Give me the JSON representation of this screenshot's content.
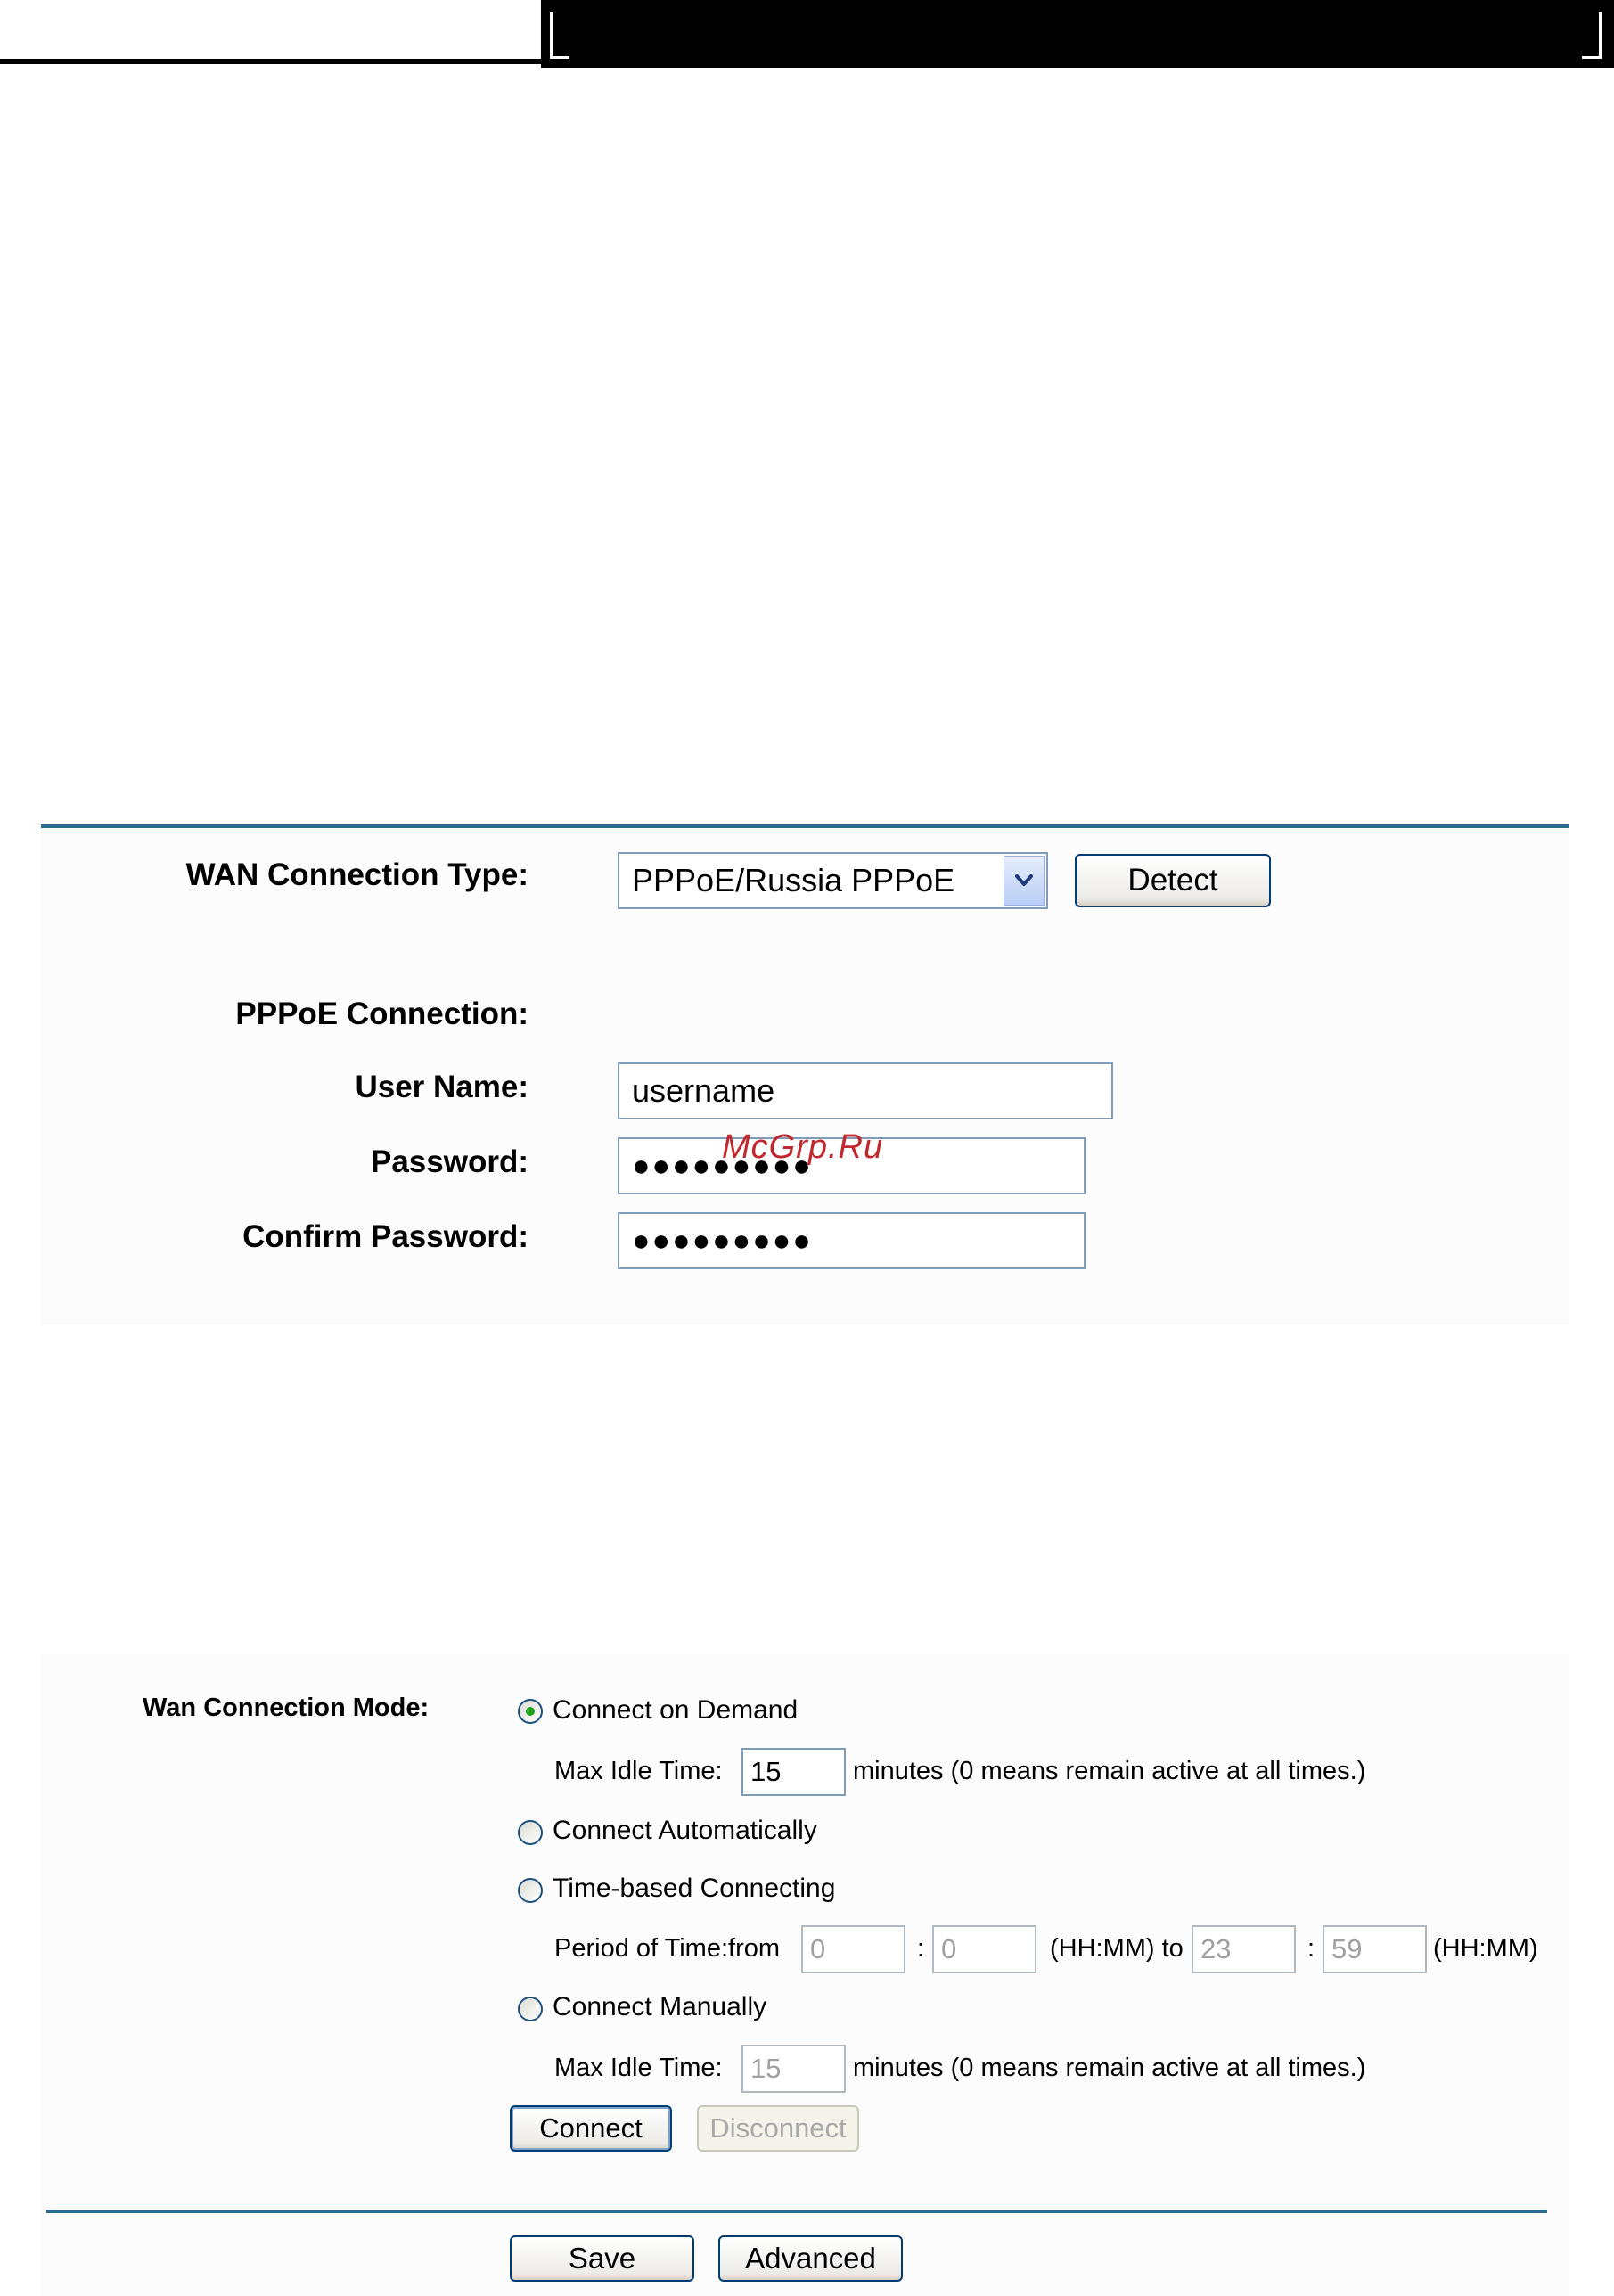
{
  "wan": {
    "connection_type_label": "WAN Connection Type:",
    "connection_type_value": "PPPoE/Russia PPPoE",
    "detect_label": "Detect"
  },
  "pppoe": {
    "section_label": "PPPoE Connection:",
    "username_label": "User Name:",
    "username_value": "username",
    "password_label": "Password:",
    "password_value": "●●●●●●●●●",
    "confirm_label": "Confirm Password:",
    "confirm_value": "●●●●●●●●●"
  },
  "watermark": "McGrp.Ru",
  "mode": {
    "label": "Wan Connection Mode:",
    "on_demand": "Connect on Demand",
    "max_idle_label": "Max Idle Time:",
    "max_idle_value": "15",
    "minutes_note": "minutes (0 means remain active at all times.)",
    "automatically": "Connect Automatically",
    "time_based": "Time-based Connecting",
    "period_label": "Period of Time:from",
    "from_hh": "0",
    "colon": ":",
    "from_mm": "0",
    "hhmm_to": "(HH:MM) to",
    "to_hh": "23",
    "to_mm": "59",
    "hhmm": "(HH:MM)",
    "manually": "Connect Manually",
    "manual_idle_label": "Max Idle Time:",
    "manual_idle_value": "15",
    "manual_minutes_note": "minutes (0 means remain active at all times.)",
    "connect_label": "Connect",
    "disconnect_label": "Disconnect",
    "selected": "on_demand"
  },
  "footer": {
    "save_label": "Save",
    "advanced_label": "Advanced"
  },
  "colors": {
    "rule": "#2a6a8e",
    "selected_radio": "#21a121",
    "button_border": "#003c74"
  }
}
